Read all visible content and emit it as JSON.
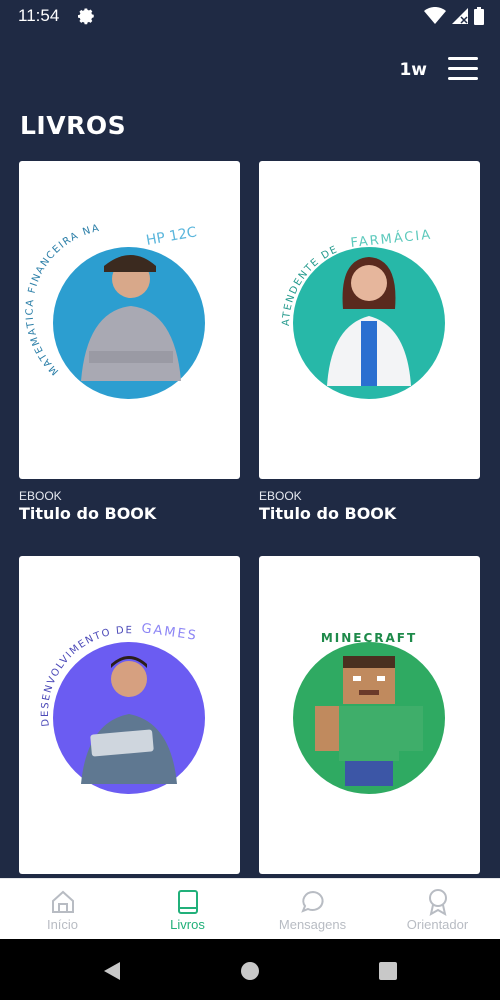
{
  "status": {
    "time": "11:54",
    "icons": [
      "gear-icon",
      "wifi-icon",
      "signal-icon",
      "battery-icon"
    ]
  },
  "header": {
    "brand": "1w",
    "menu_icon": "hamburger-menu-icon"
  },
  "page": {
    "title": "LIVROS"
  },
  "books": [
    {
      "type": "EBOOK",
      "title": "Titulo do BOOK",
      "cover_top": "HP 12C",
      "cover_arc": "MATEMATICA FINANCEIRA NA",
      "cover_color": "#2c9ed0"
    },
    {
      "type": "EBOOK",
      "title": "Titulo do BOOK",
      "cover_top": "FARMÁCIA",
      "cover_arc": "ATENDENTE DE",
      "cover_color": "#27b8a8"
    },
    {
      "type": "",
      "title": "",
      "cover_top": "GAMES",
      "cover_arc": "DESENVOLVIMENTO DE",
      "cover_color": "#6b5cf2"
    },
    {
      "type": "",
      "title": "",
      "cover_top": "MINECRAFT",
      "cover_arc": "",
      "cover_color": "#2faa62"
    }
  ],
  "nav": {
    "items": [
      {
        "label": "Início",
        "icon": "home-icon",
        "active": false
      },
      {
        "label": "Livros",
        "icon": "book-icon",
        "active": true
      },
      {
        "label": "Mensagens",
        "icon": "chat-bubble-icon",
        "active": false
      },
      {
        "label": "Orientador",
        "icon": "award-icon",
        "active": false
      }
    ]
  },
  "colors": {
    "background": "#1f2a44",
    "accent": "#21b07a",
    "nav_inactive": "#b8bcc3"
  }
}
